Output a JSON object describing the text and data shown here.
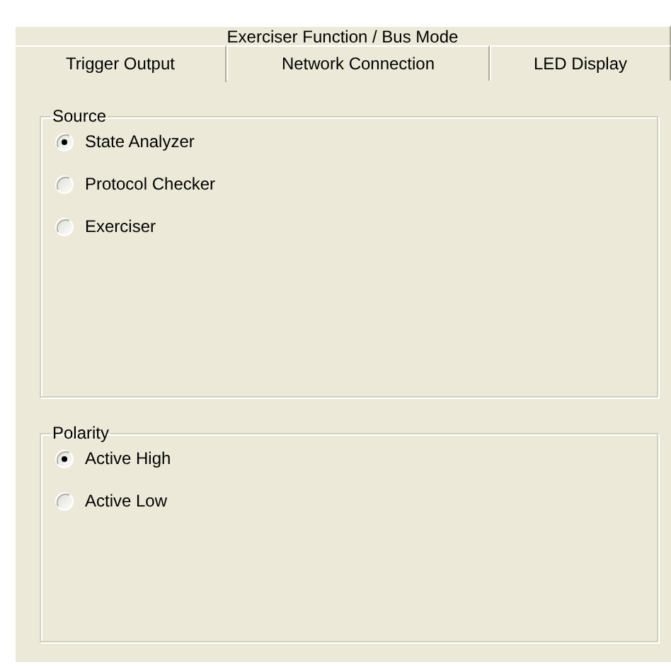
{
  "tab_rows": [
    {
      "tabs": [
        {
          "label": "Exerciser Function / Bus Mode",
          "selected": false
        }
      ]
    },
    {
      "tabs": [
        {
          "label": "Trigger Output",
          "selected": true
        },
        {
          "label": "Network Connection",
          "selected": false
        },
        {
          "label": "LED Display",
          "selected": false
        }
      ]
    }
  ],
  "groups": [
    {
      "title": "Source",
      "options": [
        {
          "label": "State Analyzer",
          "selected": true
        },
        {
          "label": "Protocol Checker",
          "selected": false
        },
        {
          "label": "Exerciser",
          "selected": false
        }
      ]
    },
    {
      "title": "Polarity",
      "options": [
        {
          "label": "Active High",
          "selected": true
        },
        {
          "label": "Active Low",
          "selected": false
        }
      ]
    }
  ]
}
